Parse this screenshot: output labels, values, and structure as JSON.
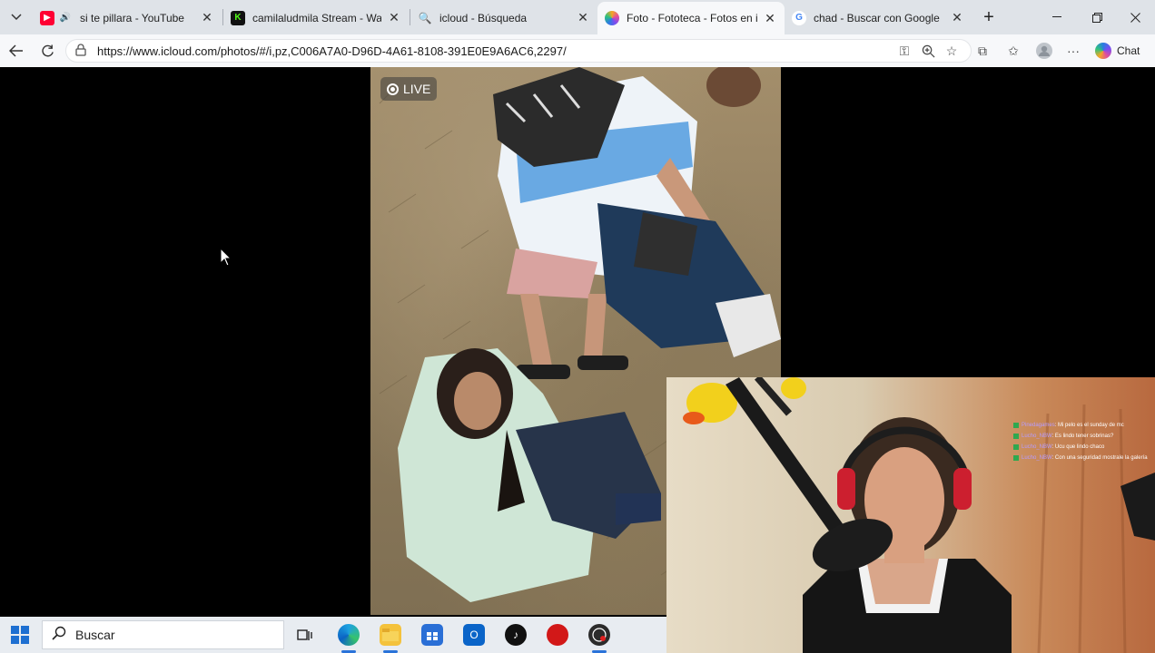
{
  "browser": {
    "tabs": [
      {
        "title": "si te pillara - YouTube",
        "favicon": "youtube-icon",
        "audio": true
      },
      {
        "title": "camilaludmila Stream - Watch Li",
        "favicon": "kick-icon"
      },
      {
        "title": "icloud - Búsqueda",
        "favicon": "search-icon"
      },
      {
        "title": "Foto - Fototeca - Fotos en iCloud",
        "favicon": "photos-icon",
        "active": true
      },
      {
        "title": "chad - Buscar con Google",
        "favicon": "google-icon"
      }
    ],
    "url": "https://www.icloud.com/photos/#/i,pz,C006A7A0-D96D-4A61-8108-391E0E9A6AC6,2297/",
    "chat_label": "Chat"
  },
  "photo": {
    "live_label": "LIVE"
  },
  "stream_chat": [
    {
      "user": "Pinedagames",
      "text": ": Mi pelo es el sunday de mc"
    },
    {
      "user": "Lucho_NBW",
      "text": ": Es lindo tener sobrinas?"
    },
    {
      "user": "Lucho_NBW",
      "text": ": Ucu que lindo chaco"
    },
    {
      "user": "Lucho_NBW",
      "text": ": Con una seguridad mostrale la galería"
    }
  ],
  "taskbar": {
    "search_placeholder": "Buscar",
    "apps": [
      "task-view-icon",
      "edge-icon",
      "file-explorer-icon",
      "store-icon",
      "outlook-icon",
      "tiktok-icon",
      "red-app-icon",
      "obs-icon"
    ]
  },
  "colors": {
    "tabbar_bg": "#dfe3e8",
    "toolbar_bg": "#f7f8fa",
    "viewer_bg": "#000000",
    "taskbar_bg": "#e8ecf1",
    "accent": "#2a73d9"
  }
}
